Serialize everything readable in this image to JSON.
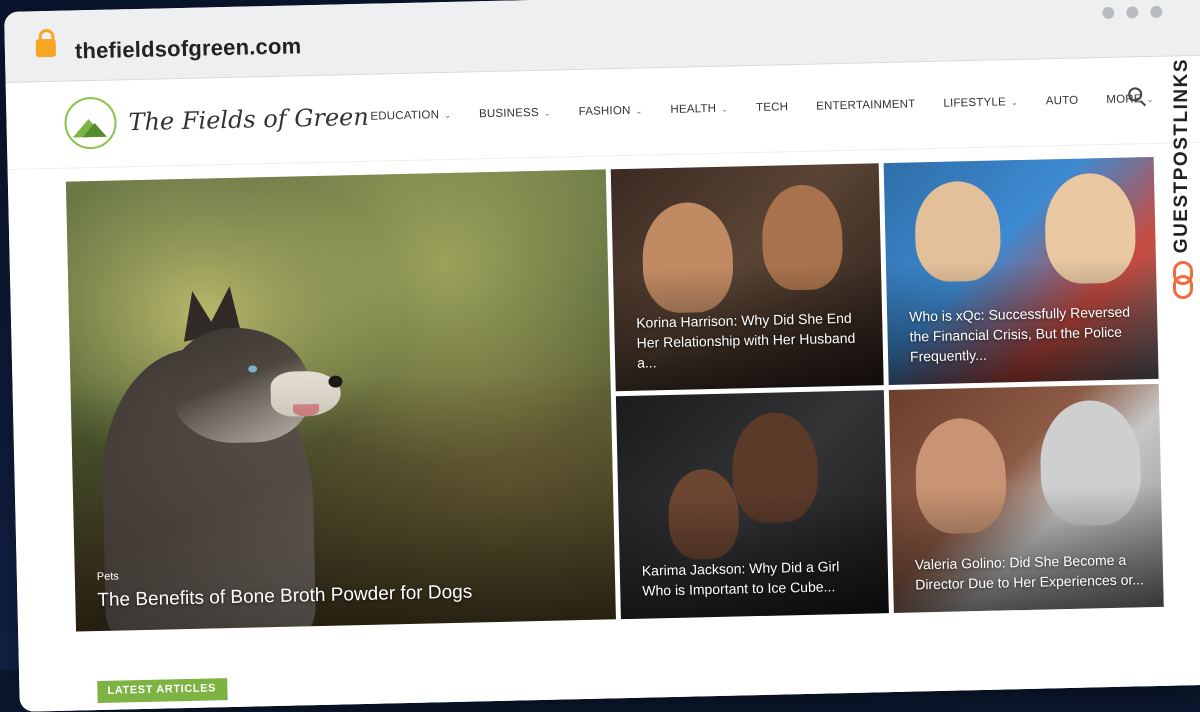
{
  "browser": {
    "url": "thefieldsofgreen.com"
  },
  "site": {
    "logo_text": "The Fields of Green",
    "nav": [
      {
        "label": "EDUCATION",
        "has_dropdown": true
      },
      {
        "label": "BUSINESS",
        "has_dropdown": true
      },
      {
        "label": "FASHION",
        "has_dropdown": true
      },
      {
        "label": "HEALTH",
        "has_dropdown": true
      },
      {
        "label": "TECH",
        "has_dropdown": false
      },
      {
        "label": "ENTERTAINMENT",
        "has_dropdown": false
      },
      {
        "label": "LIFESTYLE",
        "has_dropdown": true
      },
      {
        "label": "AUTO",
        "has_dropdown": false
      },
      {
        "label": "MORE",
        "has_dropdown": true
      }
    ],
    "search_icon": "search-icon"
  },
  "featured": {
    "main": {
      "category": "Pets",
      "title": "The Benefits of Bone Broth Powder for Dogs"
    },
    "tiles": [
      {
        "title": "Korina Harrison: Why Did She End Her Relationship with Her Husband a..."
      },
      {
        "title": "Who is xQc: Successfully Reversed the Financial Crisis, But the Police Frequently..."
      },
      {
        "title": "Karima Jackson: Why Did a Girl Who is Important to Ice Cube..."
      },
      {
        "title": "Valeria Golino: Did She Become a Director Due to Her Experiences or..."
      }
    ]
  },
  "section_badge": "LATEST ARTICLES",
  "side_brand": {
    "text": "GUESTPOSTLINKS",
    "accent_color": "#f26b3a"
  },
  "colors": {
    "brand_green": "#7cb342"
  }
}
